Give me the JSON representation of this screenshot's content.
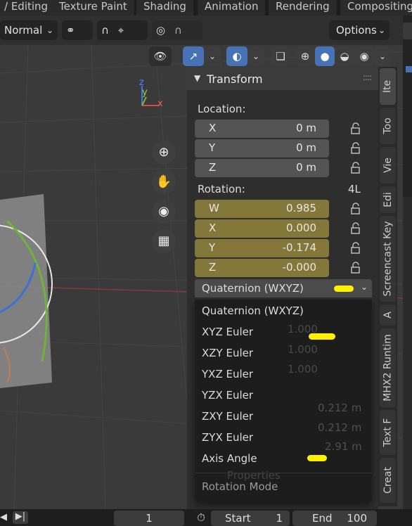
{
  "workspace_tabs": [
    "/ Editing",
    "Texture Paint",
    "Shading",
    "Animation",
    "Rendering",
    "Compositing"
  ],
  "header": {
    "mode_label": "Normal",
    "options_label": "Options"
  },
  "sidebar_tabs": [
    "Ite",
    "Too",
    "Vie",
    "Edi",
    "Screencast Key",
    "A",
    "MHX2 Runtim",
    "Text F",
    "Creat"
  ],
  "transform_panel": {
    "title": "Transform",
    "location_label": "Location:",
    "location": [
      {
        "axis": "X",
        "value": "0 m"
      },
      {
        "axis": "Y",
        "value": "0 m"
      },
      {
        "axis": "Z",
        "value": "0 m"
      }
    ],
    "rotation_label": "Rotation:",
    "rotation_extra": "4L",
    "rotation": [
      {
        "axis": "W",
        "value": "0.985"
      },
      {
        "axis": "X",
        "value": "0.000"
      },
      {
        "axis": "Y",
        "value": "-0.174"
      },
      {
        "axis": "Z",
        "value": "-0.000"
      }
    ],
    "rotation_mode_selected": "Quaternion (WXYZ)"
  },
  "rotation_mode_menu": {
    "items": [
      "Quaternion (WXYZ)",
      "XYZ Euler",
      "XZY Euler",
      "YXZ Euler",
      "YZX Euler",
      "ZXY Euler",
      "ZYX Euler",
      "Axis Angle"
    ],
    "footer": "Rotation Mode"
  },
  "behind_menu": {
    "scale_values": [
      "1.000",
      "1.000",
      "1.000"
    ],
    "dim_values": [
      "0.212 m",
      "0.212 m",
      "2.91 m"
    ],
    "properties_label": "Properties"
  },
  "bottom_bar": {
    "current_frame": "1",
    "start_label": "Start",
    "start_value": "1",
    "end_label": "End",
    "end_value": "100"
  },
  "gizmo_axes": {
    "z": "z",
    "y": "y",
    "x": "x"
  },
  "colors": {
    "rotation_field": "#84773a",
    "highlight_marker": "#fff000",
    "panel_bg": "#2e2e2e",
    "menu_bg": "#1d1d1d"
  }
}
